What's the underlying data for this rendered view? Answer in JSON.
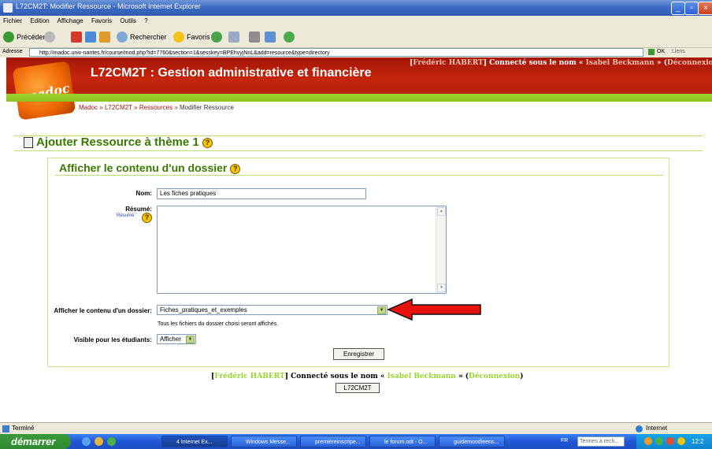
{
  "window": {
    "title": "L72CM2T: Modifier Ressource - Microsoft Internet Explorer"
  },
  "menubar": {
    "items": [
      "Fichier",
      "Edition",
      "Affichage",
      "Favoris",
      "Outils",
      "?"
    ]
  },
  "toolbar": {
    "back": "Précédente",
    "search": "Rechercher",
    "favorites": "Favoris"
  },
  "address": {
    "label": "Adresse",
    "url": "http://madoc.univ-nantes.fr/course/mod.php?id=7760&section=1&sesskey=BPEhvyjNnL&add=resource&type=directory",
    "go": "OK",
    "links": "Liens"
  },
  "site": {
    "logo": "madoc",
    "title": "L72CM2T : Gestion administrative et financière",
    "login_prefix": "[",
    "login_user1": "Frédéric HABERT",
    "login_middle": "] Connecté sous le nom «",
    "login_user2": "Isabel Beckmann",
    "login_sep": "» (",
    "login_logout": "Déconnexion",
    "login_end": ")"
  },
  "breadcrumb": {
    "items": [
      "Madoc",
      "L72CM2T",
      "Ressources"
    ],
    "separator": "»",
    "current": "Modifier Ressource"
  },
  "section": {
    "title": "Ajouter Ressource à thème 1"
  },
  "form": {
    "title": "Afficher le contenu d'un dossier",
    "name_label": "Nom:",
    "name_value": "Les fiches pratiques",
    "summary_label": "Résumé:",
    "summary_sub": "Résumé",
    "folder_label": "Afficher le contenu d'un dossier:",
    "folder_value": "Fiches_pratiques_et_exemples",
    "folder_hint": "Tous les fichiers du dossier choisi seront affichés.",
    "visible_label": "Visible pour les étudiants:",
    "visible_value": "Afficher",
    "save": "Enregistrer"
  },
  "footer": {
    "course_button": "L72CM2T"
  },
  "statusbar": {
    "status": "Terminé",
    "zone": "Internet"
  },
  "taskbar": {
    "start": "démarrer",
    "tasks": [
      "4 Internet Ex...",
      "Windows Messe...",
      "premièreinscripe...",
      "le forum.odt - O...",
      "guidemoodleens..."
    ],
    "lang": "FR",
    "search_placeholder": "Termes à rech...",
    "clock": "12:2"
  },
  "colors": {
    "header_red": "#b61f09",
    "accent_green": "#3a7900",
    "bar_green": "#8cc21c"
  }
}
